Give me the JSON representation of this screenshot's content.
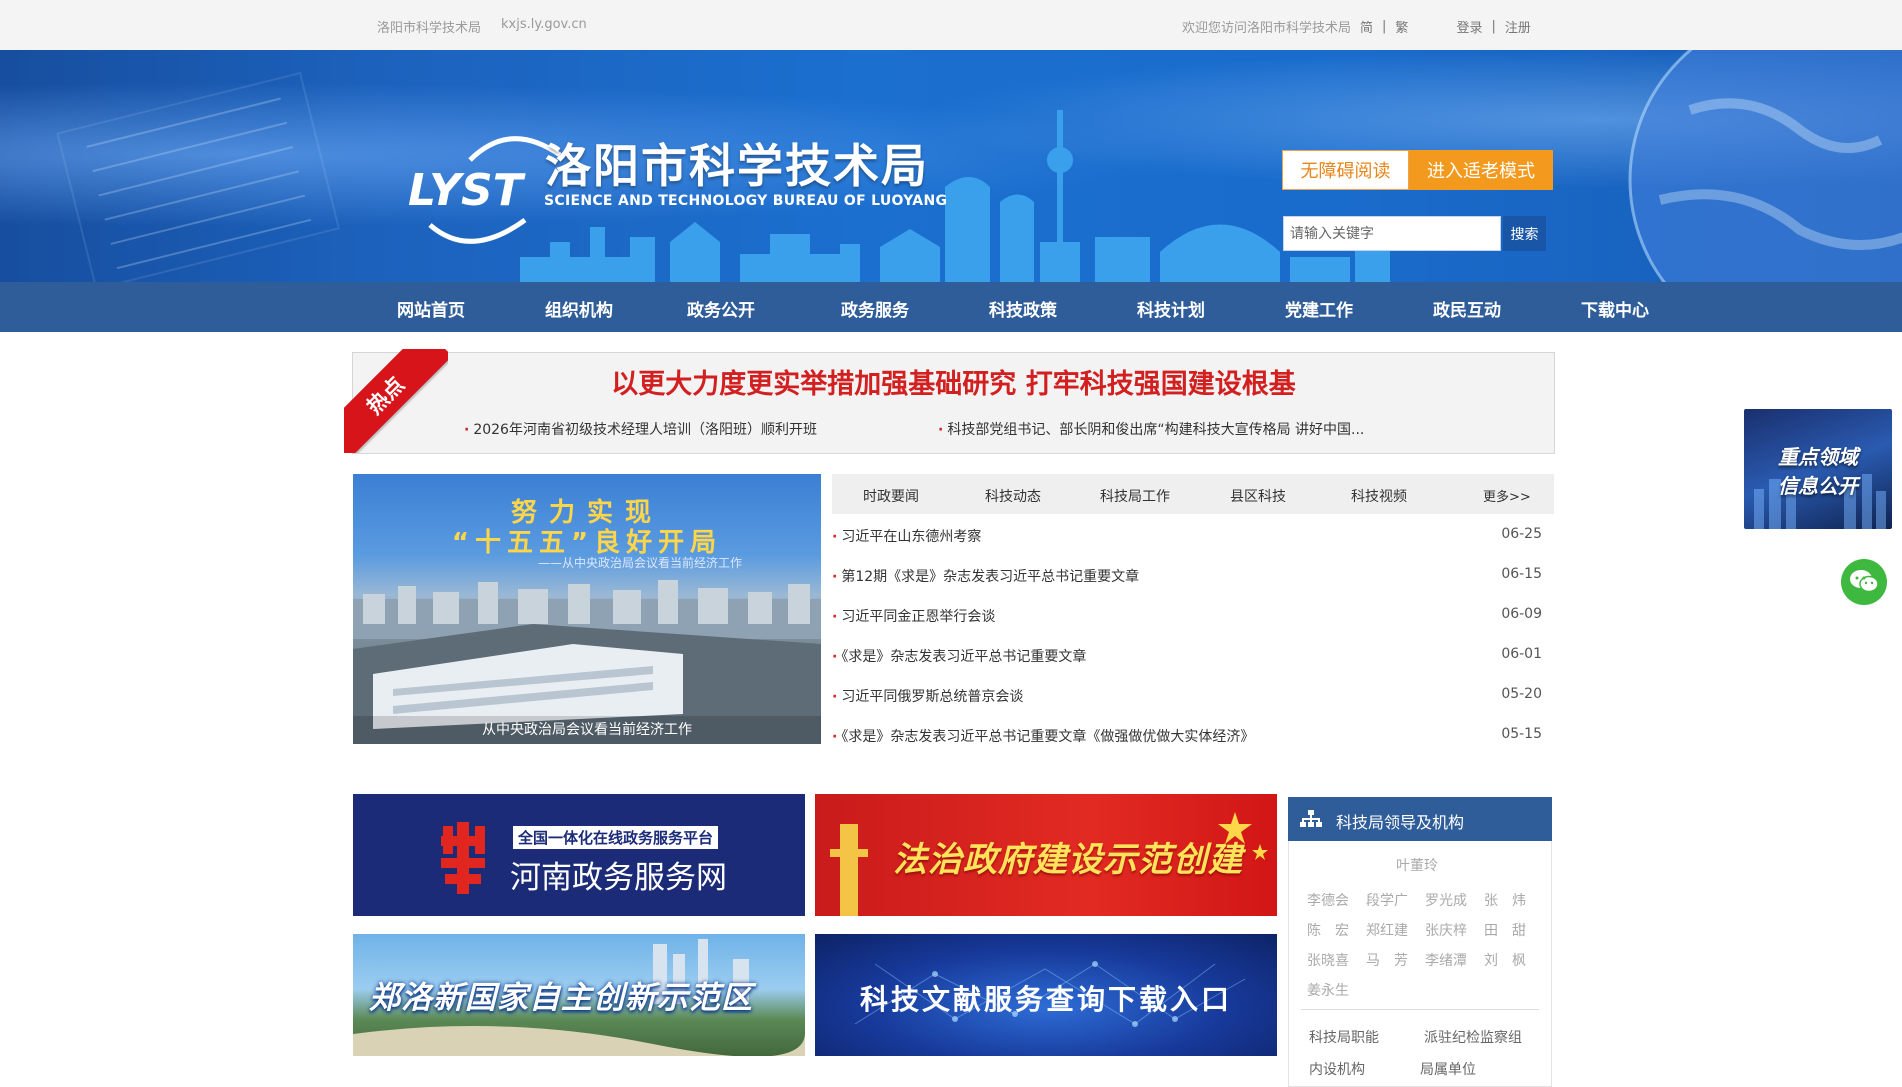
{
  "topbar": {
    "site_name": "洛阳市科学技术局",
    "domain": "kxjs.ly.gov.cn",
    "welcome": "欢迎您访问洛阳市科学技术局",
    "simplified": "简",
    "sep": "|",
    "traditional": "繁",
    "login": "登录",
    "register": "注册"
  },
  "header": {
    "logo_text": "LYST",
    "title": "洛阳市科学技术局",
    "subtitle": "SCIENCE AND TECHNOLOGY BUREAU OF LUOYANG",
    "accessible_button": "无障碍阅读",
    "elder_mode_button": "进入适老模式",
    "search_placeholder": "请输入关键字",
    "search_button": "搜索"
  },
  "nav": {
    "items": [
      "网站首页",
      "组织机构",
      "政务公开",
      "政务服务",
      "科技政策",
      "科技计划",
      "党建工作",
      "政民互动",
      "下载中心"
    ]
  },
  "hot": {
    "ribbon": "热点",
    "headline": "以更大力度更实举措加强基础研究 打牢科技强国建设根基",
    "links": [
      "2026年河南省初级技术经理人培训（洛阳班）顺利开班",
      "科技部党组书记、部长阴和俊出席“构建科技大宣传格局 讲好中国..."
    ]
  },
  "feature": {
    "heading_line1": "努力实现",
    "heading_line2": "“十五五”良好开局",
    "heading_line3": "——从中央政治局会议看当前经济工作",
    "caption": "从中央政治局会议看当前经济工作"
  },
  "news": {
    "tabs": [
      "时政要闻",
      "科技动态",
      "科技局工作",
      "县区科技",
      "科技视频"
    ],
    "more": "更多>>",
    "items": [
      {
        "title": "习近平在山东德州考察",
        "date": "06-25"
      },
      {
        "title": "第12期《求是》杂志发表习近平总书记重要文章",
        "date": "06-15"
      },
      {
        "title": "习近平同金正恩举行会谈",
        "date": "06-09"
      },
      {
        "title": "《求是》杂志发表习近平总书记重要文章",
        "date": "06-01"
      },
      {
        "title": "习近平同俄罗斯总统普京会谈",
        "date": "05-20"
      },
      {
        "title": "《求是》杂志发表习近平总书记重要文章《做强做优做大实体经济》",
        "date": "05-15"
      }
    ]
  },
  "float": {
    "card_line1": "重点领域",
    "card_line2": "信息公开"
  },
  "banners": {
    "henan_badge": "全国一体化在线政务服务平台",
    "henan_title": "河南政务服务网",
    "law_title": "法治政府建设示范创建",
    "zhengluo_title": "郑洛新国家自主创新示范区",
    "literature_title": "科技文献服务查询下载入口"
  },
  "leadership": {
    "title": "科技局领导及机构",
    "head": "叶董玲",
    "names": [
      "李德会",
      "段学广",
      "罗光成",
      "张　炜",
      "陈　宏",
      "郑红建",
      "张庆梓",
      "田　甜",
      "张晓喜",
      "马　芳",
      "李绪潭",
      "刘　枫",
      "姜永生"
    ],
    "links": [
      "科技局职能",
      "派驻纪检监察组",
      "内设机构",
      "局属单位"
    ]
  },
  "colors": {
    "nav_bg": "#2f5d9a",
    "hot_red": "#d21f1f",
    "elder_orange": "#f39a1e"
  }
}
